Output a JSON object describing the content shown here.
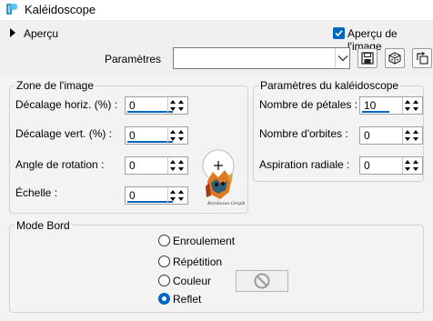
{
  "window": {
    "title": "Kaléidoscope",
    "background_color": "#f0f0f0"
  },
  "header": {
    "preview_expander_label": "Aperçu",
    "preview_checkbox_label": "Aperçu de l'image",
    "preview_checkbox_checked": true,
    "params_label": "Paramètres",
    "params_value": "",
    "tool_icons": [
      "save-icon",
      "random-dice-icon",
      "reset-icon"
    ]
  },
  "zone_image": {
    "title": "Zone de l'image",
    "fields": [
      {
        "label": "Décalage horiz. (%) :",
        "value": "0"
      },
      {
        "label": "Décalage vert. (%) :",
        "value": "0"
      },
      {
        "label": "Angle de rotation :",
        "value": "0"
      },
      {
        "label": "Échelle :",
        "value": "0"
      }
    ],
    "preview_caption": "Bordeaux-Graph"
  },
  "kaleido_params": {
    "title": "Paramètres du kaléidoscope",
    "fields": [
      {
        "label": "Nombre de pétales :",
        "value": "10"
      },
      {
        "label": "Nombre d'orbites :",
        "value": "0"
      },
      {
        "label": "Aspiration radiale :",
        "value": "0"
      }
    ]
  },
  "edge_mode": {
    "title": "Mode Bord",
    "options": [
      {
        "label": "Enroulement",
        "selected": false
      },
      {
        "label": "Répétition",
        "selected": false
      },
      {
        "label": "Couleur",
        "selected": false
      },
      {
        "label": "Reflet",
        "selected": true
      }
    ],
    "color_icon": "no-color-icon"
  },
  "colors": {
    "accent": "#0067c0"
  }
}
